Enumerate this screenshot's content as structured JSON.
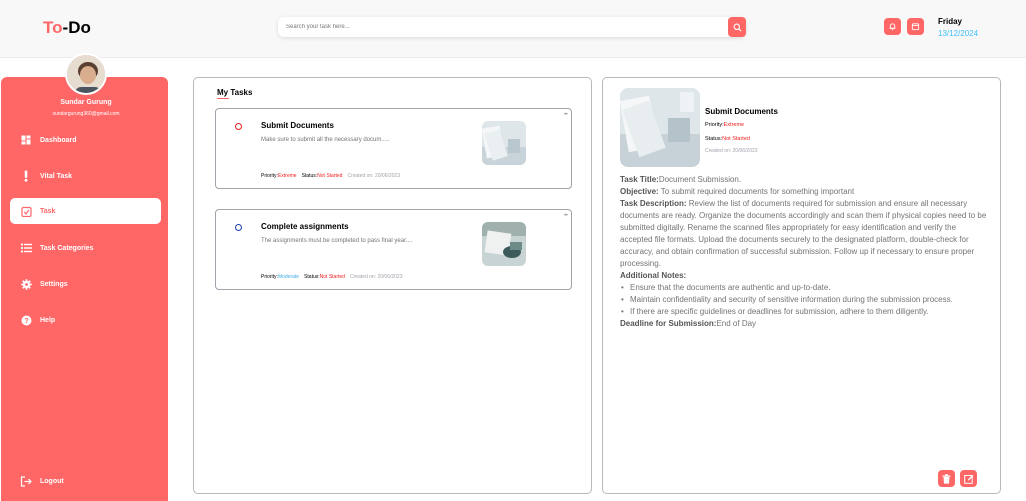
{
  "app": {
    "logo_part1": "To",
    "logo_sep": "-",
    "logo_part2": "Do"
  },
  "search": {
    "placeholder": "Search your task here..."
  },
  "header": {
    "day": "Friday",
    "date": "13/12/2024"
  },
  "user": {
    "name": "Sundar Gurung",
    "email": "sundargurung360@gmail.com"
  },
  "nav": {
    "items": [
      {
        "label": "Dashboard",
        "icon": "dashboard-icon"
      },
      {
        "label": "Vital Task",
        "icon": "exclamation-icon"
      },
      {
        "label": "Task",
        "icon": "task-check-icon"
      },
      {
        "label": "Task Categories",
        "icon": "list-icon"
      },
      {
        "label": "Settings",
        "icon": "gear-icon"
      },
      {
        "label": "Help",
        "icon": "help-icon"
      }
    ],
    "logout": "Logout"
  },
  "tasks": {
    "title": "My Tasks",
    "items": [
      {
        "title": "Submit Documents",
        "desc": "Make sure to submit all the necessary docum.....",
        "priority_label": "Priority:",
        "priority": "Extreme",
        "status_label": "Status:",
        "status": "Not Started",
        "created": "Created on: 20/06/2023"
      },
      {
        "title": "Complete assignments",
        "desc": "The assignments must be completed to pass final year....",
        "priority_label": "Priority:",
        "priority": "Moderate",
        "status_label": "Status:",
        "status": "Not Started",
        "created": "Created on: 20/06/2023"
      }
    ]
  },
  "detail": {
    "title": "Submit Documents",
    "priority_label": "Priority:",
    "priority": "Extreme",
    "status_label": "Status:",
    "status": "Not Started",
    "created": "Created on: 20/06/2023",
    "task_title_label": "Task Title:",
    "task_title": "Document Submission.",
    "objective_label": "Objective:",
    "objective": "To submit required documents for something important",
    "desc_label": "Task Description:",
    "desc": "Review the list of documents required for submission and ensure all necessary documents are ready. Organize the documents accordingly and scan them if physical copies need to be submitted digitally. Rename the scanned files appropriately for easy identification and verify the accepted file formats. Upload the documents securely to the designated platform, double-check for accuracy, and obtain confirmation of successful submission. Follow up if necessary to ensure proper processing.",
    "notes_label": "Additional Notes:",
    "notes": [
      "Ensure that the documents are authentic and up-to-date.",
      "Maintain confidentiality and security of sensitive information during the submission process.",
      "If there are specific guidelines or deadlines for submission, adhere to them diligently."
    ],
    "deadline_label": "Deadline for Submission:",
    "deadline": "End of Day"
  },
  "colors": {
    "accent": "#ff6767",
    "extreme": "#f21e1e",
    "moderate": "#42ade2",
    "date": "#3abeff"
  }
}
